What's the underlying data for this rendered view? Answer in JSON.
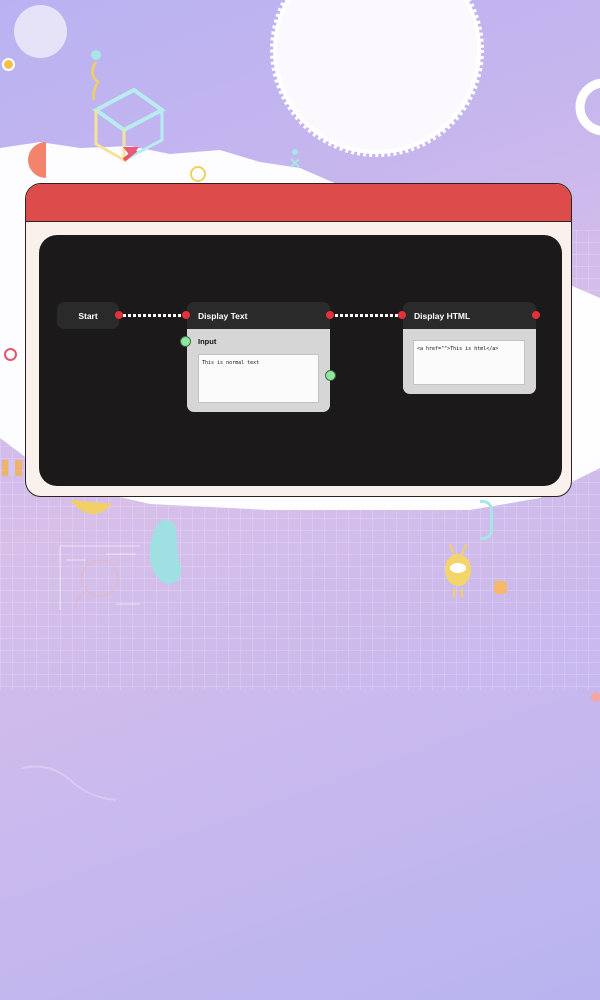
{
  "graph": {
    "nodes": {
      "start": {
        "title": "Start"
      },
      "display_text": {
        "title": "Display Text",
        "input_label": "Input",
        "text_value": "This is normal text"
      },
      "display_html": {
        "title": "Display HTML",
        "html_value": "<a href=\"\">This is html</a>"
      }
    }
  },
  "colors": {
    "titlebar": "#de4b4b",
    "canvas": "#1b1919",
    "port_out": "#e5303a",
    "port_in": "#8fe6a1"
  }
}
